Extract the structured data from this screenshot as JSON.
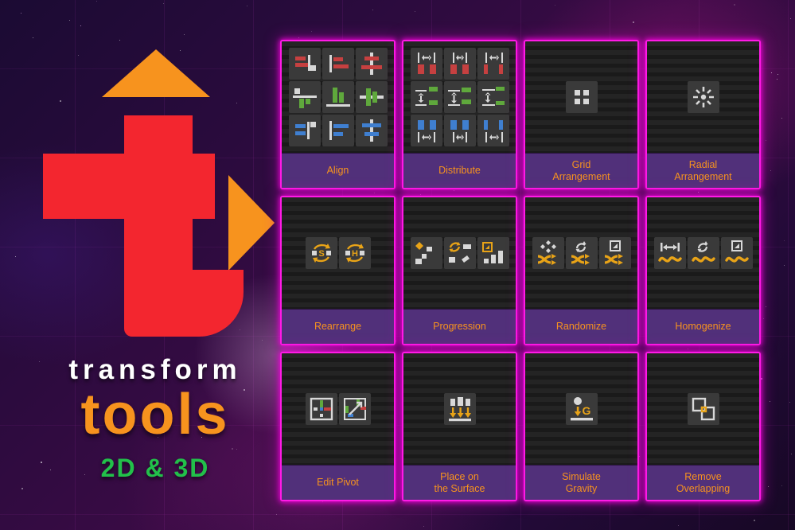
{
  "logo": {
    "word_top": "transform",
    "word_main": "tools",
    "word_sub": "2D & 3D",
    "colors": {
      "letter_red": "#f3262f",
      "arrow_orange": "#f7931e",
      "tools_orange": "#f7931e",
      "sub_green": "#22c04a",
      "transform_white": "#ffffff"
    },
    "shapes": [
      "triangle-up-icon",
      "triangle-right-icon",
      "letter-t-icon"
    ]
  },
  "theme": {
    "card_border": "#ff1ae6",
    "card_label_bg": "#51307a",
    "card_label_text": "#f7931e",
    "card_body_bg": "#1f1f1f",
    "background": "#2a0b3d"
  },
  "cards": [
    {
      "id": "align",
      "label": "Align",
      "lines": [
        "Align"
      ],
      "icon_count": 9
    },
    {
      "id": "distribute",
      "label": "Distribute",
      "lines": [
        "Distribute"
      ],
      "icon_count": 9
    },
    {
      "id": "grid-arrangement",
      "label": "Grid Arrangement",
      "lines": [
        "Grid",
        "Arrangement"
      ],
      "icon_count": 1
    },
    {
      "id": "radial-arrangement",
      "label": "Radial Arrangement",
      "lines": [
        "Radial",
        "Arrangement"
      ],
      "icon_count": 1
    },
    {
      "id": "rearrange",
      "label": "Rearrange",
      "lines": [
        "Rearrange"
      ],
      "icon_count": 2
    },
    {
      "id": "progression",
      "label": "Progression",
      "lines": [
        "Progression"
      ],
      "icon_count": 3
    },
    {
      "id": "randomize",
      "label": "Randomize",
      "lines": [
        "Randomize"
      ],
      "icon_count": 3
    },
    {
      "id": "homogenize",
      "label": "Homogenize",
      "lines": [
        "Homogenize"
      ],
      "icon_count": 3
    },
    {
      "id": "edit-pivot",
      "label": "Edit Pivot",
      "lines": [
        "Edit Pivot"
      ],
      "icon_count": 2
    },
    {
      "id": "place-on-surface",
      "label": "Place on the Surface",
      "lines": [
        "Place on",
        "the Surface"
      ],
      "icon_count": 1
    },
    {
      "id": "simulate-gravity",
      "label": "Simulate Gravity",
      "lines": [
        "Simulate",
        "Gravity"
      ],
      "icon_count": 1
    },
    {
      "id": "remove-overlapping",
      "label": "Remove Overlapping",
      "lines": [
        "Remove",
        "Overlapping"
      ],
      "icon_count": 1
    }
  ],
  "icon_names": {
    "align": [
      "align-left-red-icon",
      "align-right-red-icon",
      "align-center-h-red-icon",
      "align-top-green-icon",
      "align-bottom-green-icon",
      "align-middle-v-green-icon",
      "align-left-blue-icon",
      "align-right-blue-icon",
      "align-center-blue-icon"
    ],
    "distribute": [
      "distribute-h-gap-red-icon",
      "distribute-h-center-red-icon",
      "distribute-h-edge-red-icon",
      "distribute-v-gap-green-icon",
      "distribute-v-center-green-icon",
      "distribute-v-edge-green-icon",
      "distribute-h-gap-blue-icon",
      "distribute-h-center-blue-icon",
      "distribute-h-edge-blue-icon"
    ],
    "grid-arrangement": [
      "grid-dots-icon"
    ],
    "radial-arrangement": [
      "radial-burst-icon"
    ],
    "rearrange": [
      "rearrange-sort-s-icon",
      "rearrange-sort-h-icon"
    ],
    "progression": [
      "progression-position-icon",
      "progression-rotation-icon",
      "progression-scale-icon"
    ],
    "randomize": [
      "randomize-position-icon",
      "randomize-rotation-icon",
      "randomize-scale-icon"
    ],
    "homogenize": [
      "homogenize-position-icon",
      "homogenize-rotation-icon",
      "homogenize-scale-icon"
    ],
    "edit-pivot": [
      "pivot-set-icon",
      "pivot-move-icon"
    ],
    "place-on-surface": [
      "drop-to-surface-icon"
    ],
    "simulate-gravity": [
      "gravity-ball-icon"
    ],
    "remove-overlapping": [
      "overlap-squares-icon"
    ]
  }
}
